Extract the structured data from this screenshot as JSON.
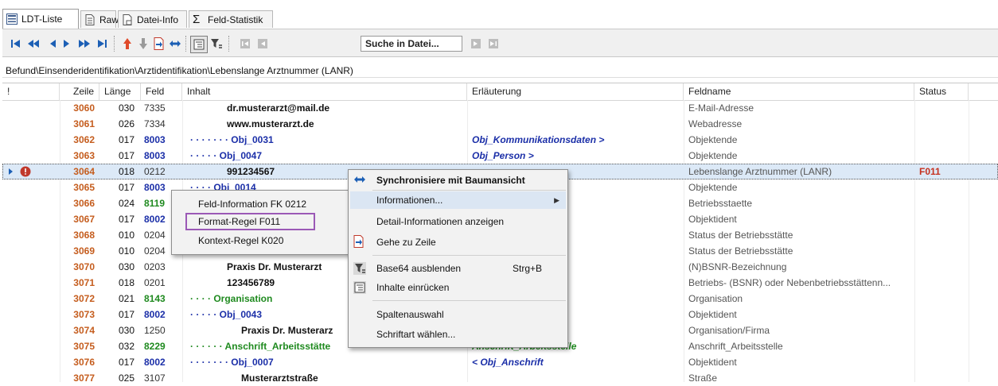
{
  "tabs": [
    {
      "label": "LDT-Liste",
      "icon": "list-icon"
    },
    {
      "label": "Raw",
      "icon": "document-icon"
    },
    {
      "label": "Datei-Info",
      "icon": "file-info-icon"
    },
    {
      "label": "Feld-Statistik",
      "icon": "sigma-icon"
    }
  ],
  "toolbar": {
    "search_placeholder": "Suche in Datei..."
  },
  "breadcrumb": "Befund\\Einsenderidentifikation\\Arztidentifikation\\Lebenslange Arztnummer (LANR)",
  "columns": {
    "flag": "!",
    "zeile": "Zeile",
    "laenge": "Länge",
    "feld": "Feld",
    "inhalt": "Inhalt",
    "erlaeuterung": "Erläuterung",
    "feldname": "Feldname",
    "status": "Status"
  },
  "rows": [
    {
      "zeile": "3060",
      "laenge": "030",
      "feld": "7335",
      "inhalt": "dr.musterarzt@mail.de",
      "erl": "",
      "feldname": "E-Mail-Adresse",
      "status": ""
    },
    {
      "zeile": "3061",
      "laenge": "026",
      "feld": "7334",
      "inhalt": "www.musterarzt.de",
      "erl": "",
      "feldname": "Webadresse",
      "status": ""
    },
    {
      "zeile": "3062",
      "laenge": "017",
      "feld": "8003",
      "inhalt": "· · · · · · · Obj_0031",
      "erl": "Obj_Kommunikationsdaten >",
      "feldname": "Objektende",
      "status": ""
    },
    {
      "zeile": "3063",
      "laenge": "017",
      "feld": "8003",
      "inhalt": "· · · · · Obj_0047",
      "erl": "Obj_Person >",
      "feldname": "Objektende",
      "status": ""
    },
    {
      "zeile": "3064",
      "laenge": "018",
      "feld": "0212",
      "inhalt": "991234567",
      "erl": "",
      "feldname": "Lebenslange Arztnummer (LANR)",
      "status": "F011"
    },
    {
      "zeile": "3065",
      "laenge": "017",
      "feld": "8003",
      "inhalt": "· · · · Obj_0014",
      "erl": "tion >",
      "feldname": "Objektende",
      "status": ""
    },
    {
      "zeile": "3066",
      "laenge": "024",
      "feld": "8119",
      "inhalt": "",
      "erl": "",
      "feldname": "Betriebsstaette",
      "status": ""
    },
    {
      "zeile": "3067",
      "laenge": "017",
      "feld": "8002",
      "inhalt": "",
      "erl": "ette",
      "feldname": "Objektident",
      "status": ""
    },
    {
      "zeile": "3068",
      "laenge": "010",
      "feld": "0204",
      "inhalt": "",
      "erl": "",
      "feldname": "Status der Betriebsstätte",
      "status": ""
    },
    {
      "zeile": "3069",
      "laenge": "010",
      "feld": "0204",
      "inhalt": "",
      "erl": "",
      "feldname": "Status der Betriebsstätte",
      "status": ""
    },
    {
      "zeile": "3070",
      "laenge": "030",
      "feld": "0203",
      "inhalt": "Praxis Dr. Musterarzt",
      "erl": "",
      "feldname": "(N)BSNR-Bezeichnung",
      "status": ""
    },
    {
      "zeile": "3071",
      "laenge": "018",
      "feld": "0201",
      "inhalt": "123456789",
      "erl": "",
      "feldname": "Betriebs- (BSNR) oder Nebenbetriebsstättenn...",
      "status": ""
    },
    {
      "zeile": "3072",
      "laenge": "021",
      "feld": "8143",
      "inhalt": "· · · · Organisation",
      "erl": "",
      "feldname": "Organisation",
      "status": ""
    },
    {
      "zeile": "3073",
      "laenge": "017",
      "feld": "8002",
      "inhalt": "· · · · · Obj_0043",
      "erl": "n",
      "feldname": "Objektident",
      "status": ""
    },
    {
      "zeile": "3074",
      "laenge": "030",
      "feld": "1250",
      "inhalt": "Praxis Dr. Musterarz",
      "erl": "",
      "feldname": "Organisation/Firma",
      "status": ""
    },
    {
      "zeile": "3075",
      "laenge": "032",
      "feld": "8229",
      "inhalt": "· · · · · · Anschrift_Arbeitsstätte",
      "erl": "Anschrift_Arbeitsstelle",
      "feldname": "Anschrift_Arbeitsstelle",
      "status": ""
    },
    {
      "zeile": "3076",
      "laenge": "017",
      "feld": "8002",
      "inhalt": "· · · · · · · Obj_0007",
      "erl": "< Obj_Anschrift",
      "feldname": "Objektident",
      "status": ""
    },
    {
      "zeile": "3077",
      "laenge": "025",
      "feld": "3107",
      "inhalt": "Musterarztstraße",
      "erl": "",
      "feldname": "Straße",
      "status": ""
    }
  ],
  "context_menu": {
    "items": [
      {
        "label": "Synchronisiere mit Baumansicht",
        "icon": "sync-arrows-icon"
      },
      {
        "label": "Informationen...",
        "icon": ""
      },
      {
        "label": "Detail-Informationen anzeigen",
        "icon": ""
      },
      {
        "label": "Gehe zu Zeile",
        "icon": "goto-line-icon"
      },
      {
        "label": "Base64 ausblenden",
        "shortcut": "Strg+B",
        "icon": "filter-icon"
      },
      {
        "label": "Inhalte einrücken",
        "icon": "indent-icon"
      },
      {
        "label": "Spaltenauswahl",
        "icon": ""
      },
      {
        "label": "Schriftart wählen...",
        "icon": ""
      }
    ]
  },
  "submenu": {
    "items": [
      {
        "label": "Feld-Information FK 0212"
      },
      {
        "label": "Format-Regel F011"
      },
      {
        "label": "Kontext-Regel K020"
      }
    ]
  },
  "colors": {
    "zeile": "#c55d1e",
    "blue": "#1b2fa8",
    "green": "#1f8a1f",
    "status": "#c5301e",
    "selection": "#dce9f7",
    "highlight_border": "#9b59b6"
  }
}
